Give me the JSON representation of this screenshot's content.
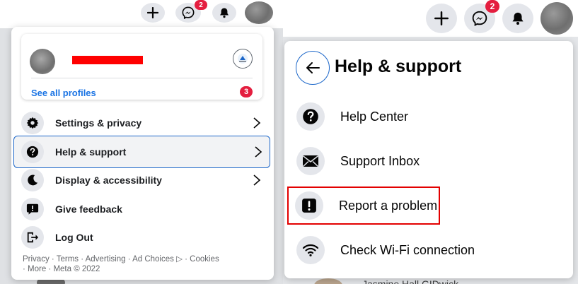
{
  "left": {
    "topbar": {
      "messenger_badge": "2"
    },
    "profile": {
      "see_all_label": "See all profiles",
      "see_all_count": "3"
    },
    "menu_items": [
      {
        "label": "Settings & privacy",
        "icon": "gear-icon",
        "chevron": true
      },
      {
        "label": "Help & support",
        "icon": "question-icon",
        "chevron": true,
        "selected": true
      },
      {
        "label": "Display & accessibility",
        "icon": "moon-icon",
        "chevron": true
      },
      {
        "label": "Give feedback",
        "icon": "feedback-icon",
        "chevron": false
      },
      {
        "label": "Log Out",
        "icon": "logout-icon",
        "chevron": false
      }
    ],
    "footer": {
      "line1": "Privacy · Terms · Advertising · Ad Choices ▷ · Cookies",
      "line2": "· More · Meta © 2022"
    }
  },
  "right": {
    "topbar": {
      "messenger_badge": "2"
    },
    "title": "Help & support",
    "menu_items": [
      {
        "label": "Help Center",
        "icon": "question-icon"
      },
      {
        "label": "Support Inbox",
        "icon": "envelope-icon"
      },
      {
        "label": "Report a problem",
        "icon": "exclamation-icon",
        "highlighted": true
      },
      {
        "label": "Check Wi-Fi connection",
        "icon": "wifi-icon"
      }
    ],
    "background_peek_text": "Jasmine Hall GIDwick"
  },
  "colors": {
    "accent": "#1b66c9",
    "badge": "#e41e3f",
    "highlight_box": "#e30000",
    "redaction": "#ff0000"
  }
}
